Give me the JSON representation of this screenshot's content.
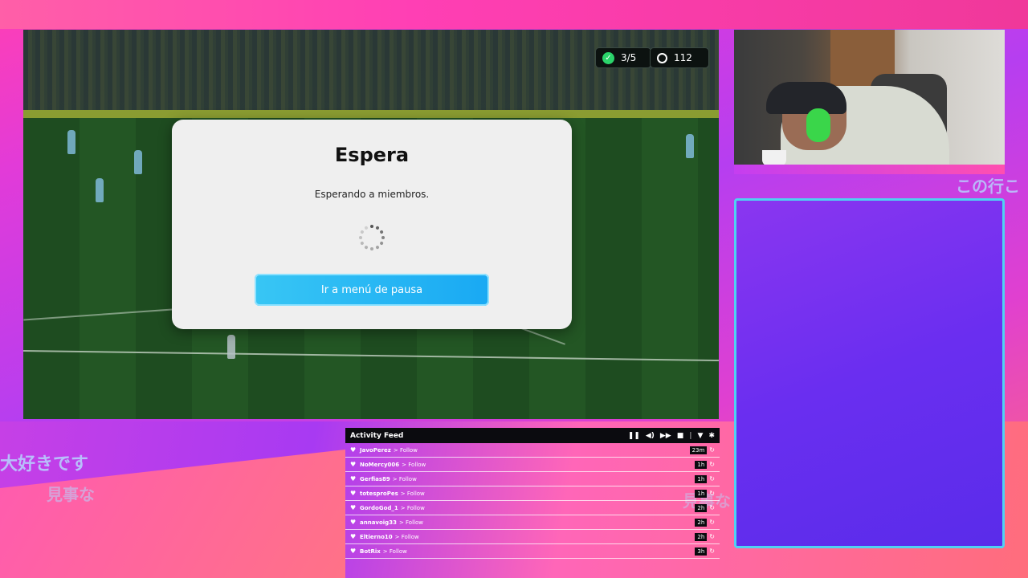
{
  "hud": {
    "members_count": "3/5",
    "timer_value": "112"
  },
  "modal": {
    "title": "Espera",
    "message": "Esperando a miembros.",
    "button_label": "Ir a menú de pausa"
  },
  "overlay_text": {
    "jp1": "大好きです",
    "jp2": "見事な",
    "jp3": "見事な",
    "jp4": "この行こ"
  },
  "activity_feed": {
    "title": "Activity Feed",
    "controls": [
      "pause-icon",
      "volume-icon",
      "skip-icon",
      "trash-icon",
      "filter-icon",
      "gear-icon"
    ],
    "rows": [
      {
        "user": "JavoPerez",
        "action": "> Follow",
        "time": "23m"
      },
      {
        "user": "NoMercy006",
        "action": "> Follow",
        "time": "1h"
      },
      {
        "user": "Gerfias89",
        "action": "> Follow",
        "time": "1h"
      },
      {
        "user": "totesproPes",
        "action": "> Follow",
        "time": "1h"
      },
      {
        "user": "GordoGod_1",
        "action": "> Follow",
        "time": "2h"
      },
      {
        "user": "annavoig33",
        "action": "> Follow",
        "time": "2h"
      },
      {
        "user": "Eltierno10",
        "action": "> Follow",
        "time": "2h"
      },
      {
        "user": "BotRix",
        "action": "> Follow",
        "time": "3h"
      }
    ]
  },
  "colors": {
    "accent_cyan": "#19a9f3",
    "check_green": "#2bd46b",
    "panel_border": "#4fd2f2"
  }
}
